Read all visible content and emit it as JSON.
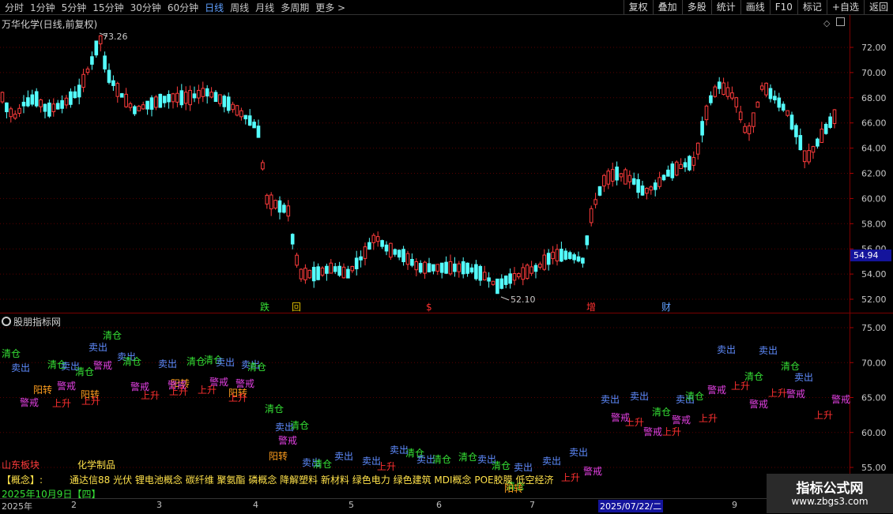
{
  "toolbar": {
    "periods": [
      "分时",
      "1分钟",
      "5分钟",
      "15分钟",
      "30分钟",
      "60分钟",
      "日线",
      "周线",
      "月线",
      "多周期",
      "更多 >"
    ],
    "active_period": "日线",
    "buttons": [
      "复权",
      "叠加",
      "多股",
      "统计",
      "画线",
      "F10",
      "标记",
      "+自选",
      "返回"
    ]
  },
  "main_chart": {
    "title": "万华化学(日线,前复权)",
    "y_ticks": [
      "72.00",
      "70.00",
      "68.00",
      "66.00",
      "64.00",
      "62.00",
      "60.00",
      "58.00",
      "56.00",
      "54.00",
      "52.00"
    ],
    "high_label": "73.26",
    "low_label": "52.10",
    "current_price": "54.94",
    "event_markers": [
      "跌",
      "回",
      "$",
      "增",
      "财"
    ]
  },
  "indicator_chart": {
    "title": "股朋指标网",
    "y_ticks": [
      "75.00",
      "70.00",
      "65.00",
      "60.00",
      "55.00"
    ],
    "signal_labels": {
      "sell": "卖出",
      "clear": "清仓",
      "warn": "警戒",
      "rise": "上升",
      "yang": "阳转"
    }
  },
  "info": {
    "region": "山东板块",
    "industry": "化学制品",
    "concept_label": "【概念】:",
    "concepts": "通达信88 光伏 锂电池概念 碳纤维 聚氨酯 磷概念 降解塑料 新材料 绿色电力 绿色建筑 MDI概念 POE胶膜 低空经济"
  },
  "bottom_axis": {
    "date": "2025年10月9日【四】",
    "year": "2025年",
    "months": [
      "2",
      "3",
      "4",
      "5",
      "6",
      "7",
      "9"
    ],
    "cursor_date": "2025/07/22/二"
  },
  "watermark": {
    "title": "指标公式网",
    "url": "www.zbgs3.com"
  },
  "colors": {
    "up": "#ff3c3c",
    "down": "#54ffff",
    "sell": "#5f8cff",
    "clear": "#35e035",
    "warn": "#e040e0",
    "rise": "#ff3030",
    "yang": "#ff9e1e"
  }
}
